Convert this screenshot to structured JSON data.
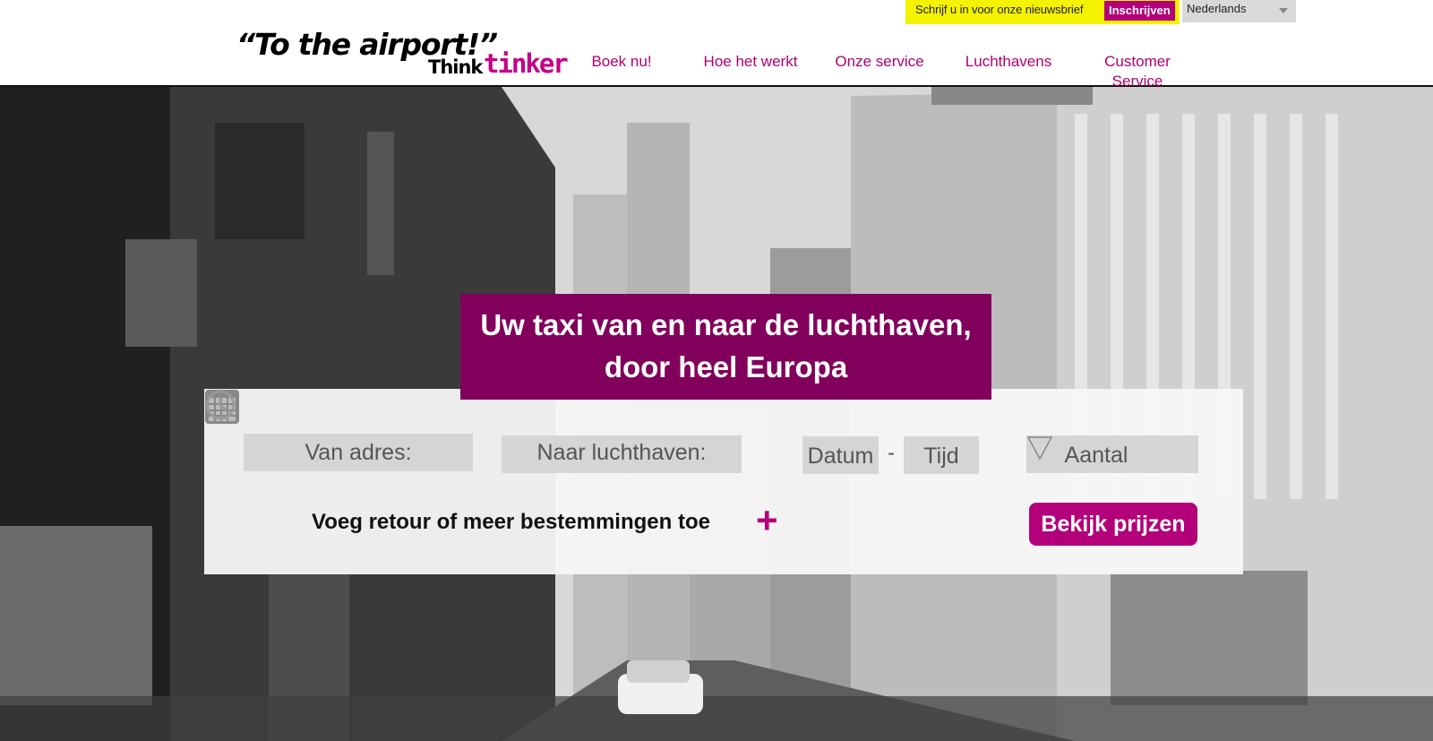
{
  "header": {
    "newsletter": {
      "text": "Schrijf u in voor onze nieuwsbrief",
      "button": "Inschrijven"
    },
    "language": {
      "selected": "Nederlands"
    },
    "logo": {
      "quote": "“To the airport!”",
      "brand_think": "Think",
      "brand_tinker": "tinker"
    },
    "nav": [
      {
        "label": "Boek nu!"
      },
      {
        "label": "Hoe het werkt"
      },
      {
        "label": "Onze service"
      },
      {
        "label": "Luchthavens"
      },
      {
        "label": "Customer Service"
      }
    ]
  },
  "hero": {
    "headline": "Uw taxi van en naar de luchthaven, door heel Europa",
    "form": {
      "from_placeholder": "Van adres:",
      "to_placeholder": "Naar luchthaven:",
      "date_placeholder": "Datum",
      "separator": "-",
      "time_placeholder": "Tijd",
      "passengers_placeholder": "Aantal",
      "add_return_label": "Voeg retour of meer bestemmingen toe",
      "add_icon_glyph": "+",
      "submit_label": "Bekijk prijzen"
    }
  },
  "colors": {
    "brand_magenta": "#b3007a",
    "headline_bg": "#80005b",
    "nav_text": "#b0006f",
    "newsletter_bg": "#f5f200"
  },
  "icons": [
    "calendar-icon",
    "clock-icon",
    "chevron-down-icon",
    "plus-icon"
  ]
}
